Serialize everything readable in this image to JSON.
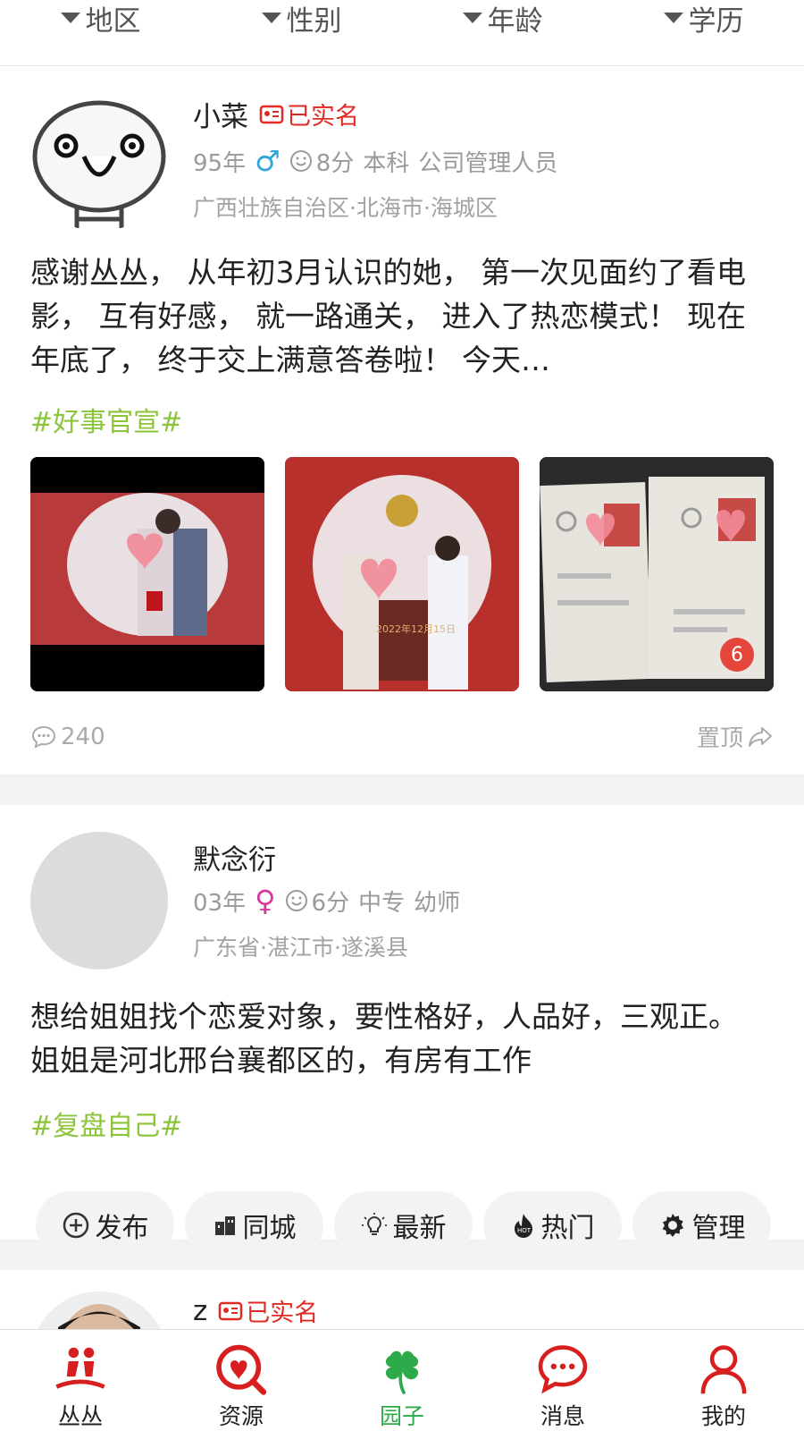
{
  "filters": [
    "地区",
    "性别",
    "年龄",
    "学历"
  ],
  "posts": [
    {
      "name": "小菜",
      "verified_label": "已实名",
      "year": "95年",
      "gender_symbol": "♂",
      "score": "8分",
      "education": "本科",
      "job": "公司管理人员",
      "location": "广西壮族自治区·北海市·海城区",
      "content": "感谢丛丛， 从年初3月认识的她， 第一次见面约了看电影， 互有好感， 就一路通关， 进入了热恋模式！ 现在年底了， 终于交上满意答卷啦！ 今天…",
      "tag": "#好事官宣#",
      "photo_count": "6",
      "photo_date": "2022年12月15日",
      "comments": "240",
      "pin_label": "置顶"
    },
    {
      "name": "默念衍",
      "year": "03年",
      "gender_symbol": "♀",
      "score": "6分",
      "education": "中专",
      "job": "幼师",
      "location": "广东省·湛江市·遂溪县",
      "content": "想给姐姐找个恋爱对象，要性格好，人品好，三观正。 姐姐是河北邢台襄都区的，有房有工作",
      "tag": "#复盘自己#"
    },
    {
      "name": "z",
      "verified_label": "已实名"
    }
  ],
  "pills": [
    {
      "label": "发布",
      "icon": "plus-circle-icon"
    },
    {
      "label": "同城",
      "icon": "city-icon"
    },
    {
      "label": "最新",
      "icon": "bulb-icon"
    },
    {
      "label": "热门",
      "icon": "fire-icon"
    },
    {
      "label": "管理",
      "icon": "gear-icon"
    }
  ],
  "nav": [
    {
      "label": "丛丛",
      "icon": "couple-icon"
    },
    {
      "label": "资源",
      "icon": "heart-search-icon"
    },
    {
      "label": "园子",
      "icon": "clover-icon"
    },
    {
      "label": "消息",
      "icon": "chat-bubble-icon"
    },
    {
      "label": "我的",
      "icon": "person-icon"
    }
  ],
  "colors": {
    "accent_red": "#e02a23",
    "tag_green": "#8cc43a",
    "active_green": "#2daa4a",
    "male_blue": "#2fa6d8",
    "female_pink": "#d6399c"
  }
}
